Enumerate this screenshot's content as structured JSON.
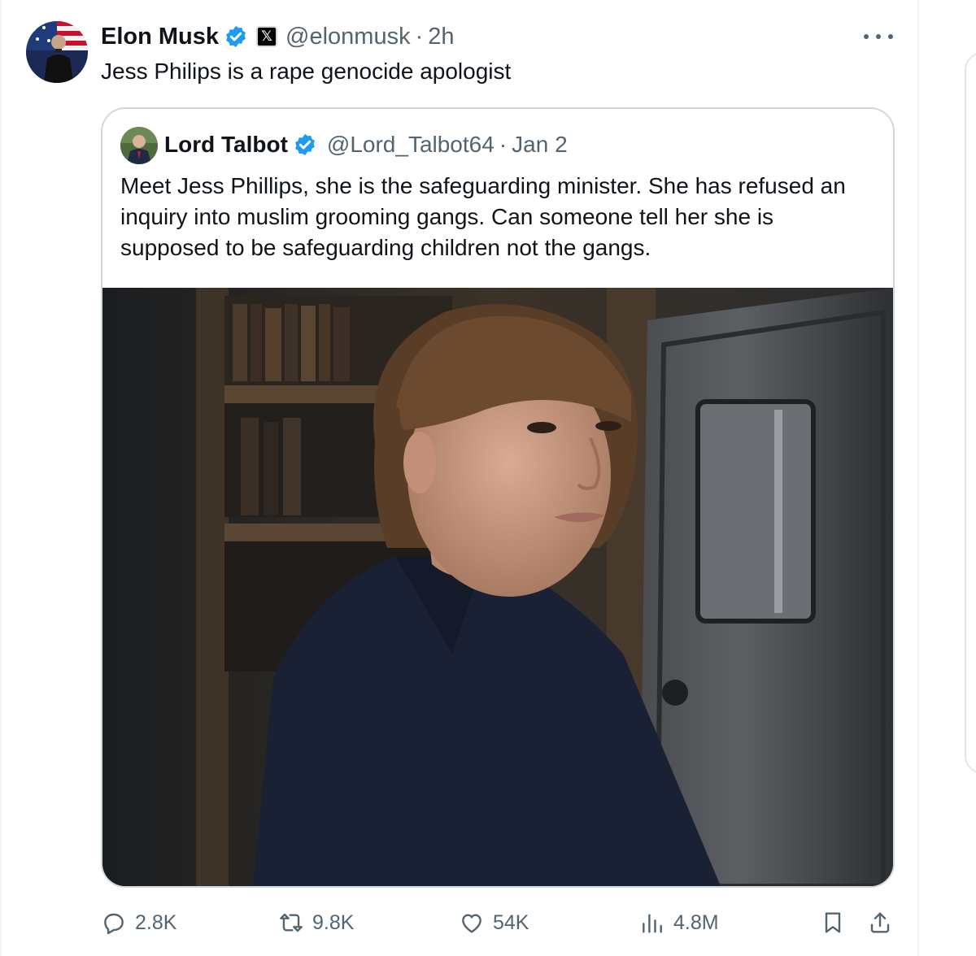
{
  "tweet": {
    "author_name": "Elon Musk",
    "handle": "@elonmusk",
    "separator": "·",
    "time": "2h",
    "affiliate_badge": "𝕏",
    "text": "Jess Philips is a rape genocide apologist"
  },
  "quoted": {
    "author_name": "Lord Talbot",
    "handle": "@Lord_Talbot64",
    "separator": "·",
    "date": "Jan 2",
    "text": "Meet Jess Phillips, she is the safeguarding minister. She has refused an inquiry into muslim grooming gangs. Can someone tell her she is supposed to be safeguarding children not the gangs."
  },
  "actions": {
    "replies": "2.8K",
    "reposts": "9.8K",
    "likes": "54K",
    "views": "4.8M"
  },
  "icons": [
    "verified-icon",
    "x-logo-icon",
    "more-icon",
    "reply-icon",
    "repost-icon",
    "like-icon",
    "views-icon",
    "bookmark-icon",
    "share-icon"
  ],
  "colors": {
    "verified_blue": "#1d9bf0",
    "text_primary": "#0f1419",
    "text_secondary": "#536471",
    "border": "#cfd9de"
  }
}
